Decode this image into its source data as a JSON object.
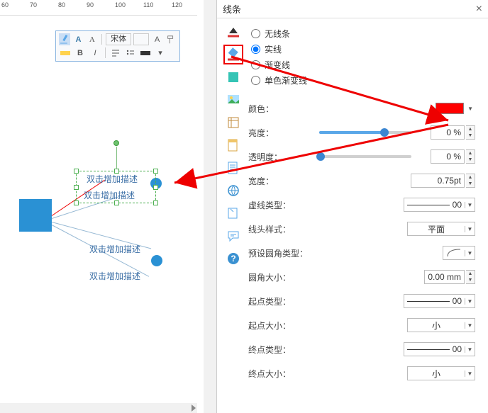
{
  "ruler": {
    "ticks": [
      "60",
      "70",
      "80",
      "90",
      "100",
      "110",
      "120"
    ]
  },
  "toolbar_labels": {
    "font": "宋体",
    "size": ""
  },
  "canvas_nodes": [
    {
      "label": "双击增加描述"
    },
    {
      "label": "双击增加描述"
    },
    {
      "label": "双击增加描述"
    },
    {
      "label": "双击增加描述"
    }
  ],
  "panel": {
    "title": "线条",
    "line_type": {
      "none": "无线条",
      "solid": "实线",
      "gradient": "渐变线",
      "onecolor_gradient": "单色渐变线",
      "selected": "solid"
    },
    "color_label": "颜色：",
    "brightness": {
      "label": "亮度：",
      "value": "0 %",
      "percent": 70
    },
    "opacity": {
      "label": "透明度：",
      "value": "0 %",
      "percent": 0
    },
    "width": {
      "label": "宽度：",
      "value": "0.75pt"
    },
    "dash": {
      "label": "虚线类型：",
      "value": "00"
    },
    "arrow_style": {
      "label": "线头样式：",
      "value": "平面"
    },
    "round_preset": {
      "label": "预设圆角类型："
    },
    "round_size": {
      "label": "圆角大小：",
      "value": "0.00 mm"
    },
    "start_type": {
      "label": "起点类型：",
      "value": "00"
    },
    "start_size": {
      "label": "起点大小：",
      "value": "小"
    },
    "end_type": {
      "label": "终点类型：",
      "value": "00"
    },
    "end_size": {
      "label": "终点大小：",
      "value": "小"
    },
    "color_value": "#ff0000"
  }
}
